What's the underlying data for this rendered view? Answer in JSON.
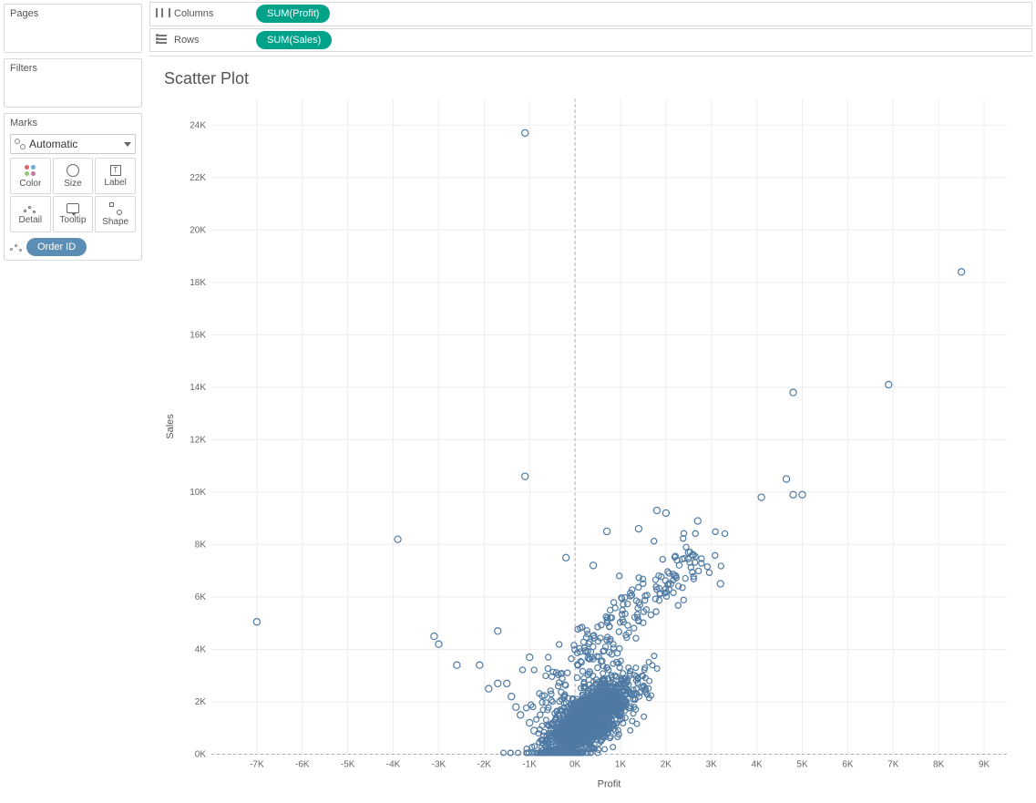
{
  "sidebar": {
    "pages_title": "Pages",
    "filters_title": "Filters",
    "marks_title": "Marks",
    "mark_type": "Automatic",
    "cells": {
      "color": "Color",
      "size": "Size",
      "label": "Label",
      "detail": "Detail",
      "tooltip": "Tooltip",
      "shape": "Shape",
      "label_glyph": "T"
    },
    "detail_pill": "Order ID"
  },
  "shelves": {
    "columns_label": "Columns",
    "columns_pill": "SUM(Profit)",
    "rows_label": "Rows",
    "rows_pill": "SUM(Sales)"
  },
  "viz": {
    "title": "Scatter Plot"
  },
  "chart_data": {
    "type": "scatter",
    "title": "Scatter Plot",
    "xlabel": "Profit",
    "ylabel": "Sales",
    "xlim": [
      -8000,
      9500
    ],
    "ylim": [
      0,
      25000
    ],
    "xticks": [
      -7000,
      -6000,
      -5000,
      -4000,
      -3000,
      -2000,
      -1000,
      0,
      1000,
      2000,
      3000,
      4000,
      5000,
      6000,
      7000,
      8000,
      9000
    ],
    "xtick_labels": [
      "-7K",
      "-6K",
      "-5K",
      "-4K",
      "-3K",
      "-2K",
      "-1K",
      "0K",
      "1K",
      "2K",
      "3K",
      "4K",
      "5K",
      "6K",
      "7K",
      "8K",
      "9K"
    ],
    "yticks": [
      0,
      2000,
      4000,
      6000,
      8000,
      10000,
      12000,
      14000,
      16000,
      18000,
      20000,
      22000,
      24000
    ],
    "ytick_labels": [
      "0K",
      "2K",
      "4K",
      "6K",
      "8K",
      "10K",
      "12K",
      "14K",
      "16K",
      "18K",
      "20K",
      "22K",
      "24K"
    ],
    "mark_color": "#4f7aa3",
    "outliers": [
      {
        "x": -1100,
        "y": 23700
      },
      {
        "x": 8500,
        "y": 18400
      },
      {
        "x": 6900,
        "y": 14100
      },
      {
        "x": 4800,
        "y": 13800
      },
      {
        "x": -1100,
        "y": 10600
      },
      {
        "x": 4650,
        "y": 10500
      },
      {
        "x": 4800,
        "y": 9900
      },
      {
        "x": 5000,
        "y": 9900
      },
      {
        "x": 4100,
        "y": 9800
      },
      {
        "x": -3900,
        "y": 8200
      },
      {
        "x": -7000,
        "y": 5050
      },
      {
        "x": 1800,
        "y": 9300
      },
      {
        "x": 2000,
        "y": 9200
      },
      {
        "x": 1400,
        "y": 8600
      },
      {
        "x": 2700,
        "y": 8900
      },
      {
        "x": 2600,
        "y": 7600
      },
      {
        "x": 2500,
        "y": 7700
      },
      {
        "x": 3200,
        "y": 6500
      },
      {
        "x": 2100,
        "y": 6500
      },
      {
        "x": 700,
        "y": 8500
      },
      {
        "x": -200,
        "y": 7500
      },
      {
        "x": 400,
        "y": 7200
      },
      {
        "x": -3100,
        "y": 4500
      },
      {
        "x": -3000,
        "y": 4200
      },
      {
        "x": -2600,
        "y": 3400
      },
      {
        "x": -2100,
        "y": 3400
      },
      {
        "x": -1700,
        "y": 2700
      },
      {
        "x": -1500,
        "y": 2700
      },
      {
        "x": -1400,
        "y": 2200
      },
      {
        "x": -1900,
        "y": 2500
      },
      {
        "x": -1300,
        "y": 1800
      },
      {
        "x": -1200,
        "y": 1500
      },
      {
        "x": -1000,
        "y": 1200
      },
      {
        "x": -900,
        "y": 900
      },
      {
        "x": -500,
        "y": 700
      },
      {
        "x": -1000,
        "y": 3700
      },
      {
        "x": -1700,
        "y": 4700
      }
    ],
    "dense_cluster": {
      "count": 1700,
      "x_center": 300,
      "y_center": 1300,
      "x_spread": 1400,
      "y_spread": 2200,
      "correlation": 0.7
    },
    "mid_fan": {
      "count": 220,
      "x_low": -800,
      "x_high": 2800,
      "y_low": 2500,
      "y_high": 6800,
      "slope": 1.9
    },
    "seed": 424242
  }
}
